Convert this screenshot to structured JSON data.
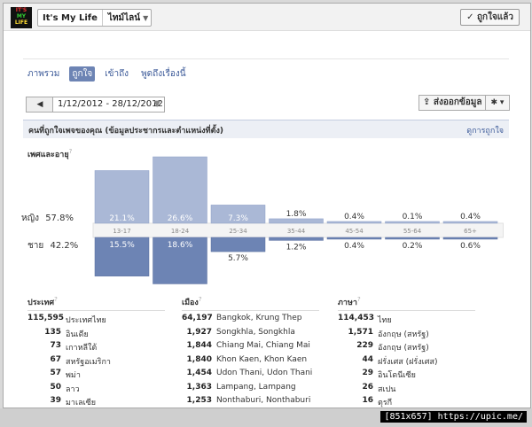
{
  "header": {
    "logo_lines": [
      "IT'S",
      "MY",
      "LIFE"
    ],
    "page_name": "It's My Life",
    "page_category": "ไทม์ไลน์",
    "like_button": "✓ ถูกใจแล้ว"
  },
  "tabs": [
    {
      "label": "ภาพรวม",
      "active": false
    },
    {
      "label": "ถูกใจ",
      "active": true
    },
    {
      "label": "เข้าถึง",
      "active": false
    },
    {
      "label": "พูดถึงเรื่องนี้",
      "active": false
    }
  ],
  "date_range": {
    "prev": "◀",
    "value": "1/12/2012 - 28/12/2012",
    "arrow": "▼"
  },
  "export_button": "⇪ ส่งออกข้อมูล",
  "gear_button": "✱ ▾",
  "section": {
    "title": "คนที่ถูกใจเพจของคุณ (ข้อมูลประชากรและตำแหน่งที่ตั้ง)",
    "link": "ดูการถูกใจ"
  },
  "age_gender": {
    "heading": "เพศและอายุ",
    "help": "?",
    "female_label": "หญิง",
    "female_pct": "57.8%",
    "male_label": "ชาย",
    "male_pct": "42.2%"
  },
  "chart_data": {
    "type": "bar",
    "title": "",
    "categories": [
      "13-17",
      "18-24",
      "25-34",
      "35-44",
      "45-54",
      "55-64",
      "65+"
    ],
    "series": [
      {
        "name": "หญิง",
        "values": [
          21.1,
          26.6,
          7.3,
          1.8,
          0.4,
          0.1,
          0.4
        ],
        "labels": [
          "21.1%",
          "26.6%",
          "7.3%",
          "1.8%",
          "0.4%",
          "0.1%",
          "0.4%"
        ],
        "color": "#aab8d6"
      },
      {
        "name": "ชาย",
        "values": [
          15.5,
          18.6,
          5.7,
          1.2,
          0.4,
          0.2,
          0.6
        ],
        "labels": [
          "15.5%",
          "18.6%",
          "5.7%",
          "1.2%",
          "0.4%",
          "0.2%",
          "0.6%"
        ],
        "color": "#6d84b4"
      }
    ],
    "xlabel": "",
    "ylabel": ""
  },
  "countries": {
    "heading": "ประเทศ",
    "help": "?",
    "rows": [
      {
        "count": "115,595",
        "name": "ประเทศไทย"
      },
      {
        "count": "135",
        "name": "อินเดีย"
      },
      {
        "count": "73",
        "name": "เกาหลีใต้"
      },
      {
        "count": "67",
        "name": "สหรัฐอเมริกา"
      },
      {
        "count": "57",
        "name": "พม่า"
      },
      {
        "count": "50",
        "name": "ลาว"
      },
      {
        "count": "39",
        "name": "มาเลเซีย"
      }
    ]
  },
  "cities": {
    "heading": "เมือง",
    "help": "?",
    "rows": [
      {
        "count": "64,197",
        "name": "Bangkok, Krung Thep"
      },
      {
        "count": "1,927",
        "name": "Songkhla, Songkhla"
      },
      {
        "count": "1,844",
        "name": "Chiang Mai, Chiang Mai"
      },
      {
        "count": "1,840",
        "name": "Khon Kaen, Khon Kaen"
      },
      {
        "count": "1,454",
        "name": "Udon Thani, Udon Thani"
      },
      {
        "count": "1,363",
        "name": "Lampang, Lampang"
      },
      {
        "count": "1,253",
        "name": "Nonthaburi, Nonthaburi"
      }
    ]
  },
  "languages": {
    "heading": "ภาษา",
    "help": "?",
    "rows": [
      {
        "count": "114,453",
        "name": "ไทย"
      },
      {
        "count": "1,571",
        "name": "อังกฤษ (สหรัฐ)"
      },
      {
        "count": "229",
        "name": "อังกฤษ (สหรัฐ)"
      },
      {
        "count": "44",
        "name": "ฝรั่งเศส (ฝรั่งเศส)"
      },
      {
        "count": "29",
        "name": "อินโดนีเซีย"
      },
      {
        "count": "26",
        "name": "สเปน"
      },
      {
        "count": "16",
        "name": "ตุรกี"
      }
    ]
  },
  "watermark": "[851x657] https://upic.me/"
}
